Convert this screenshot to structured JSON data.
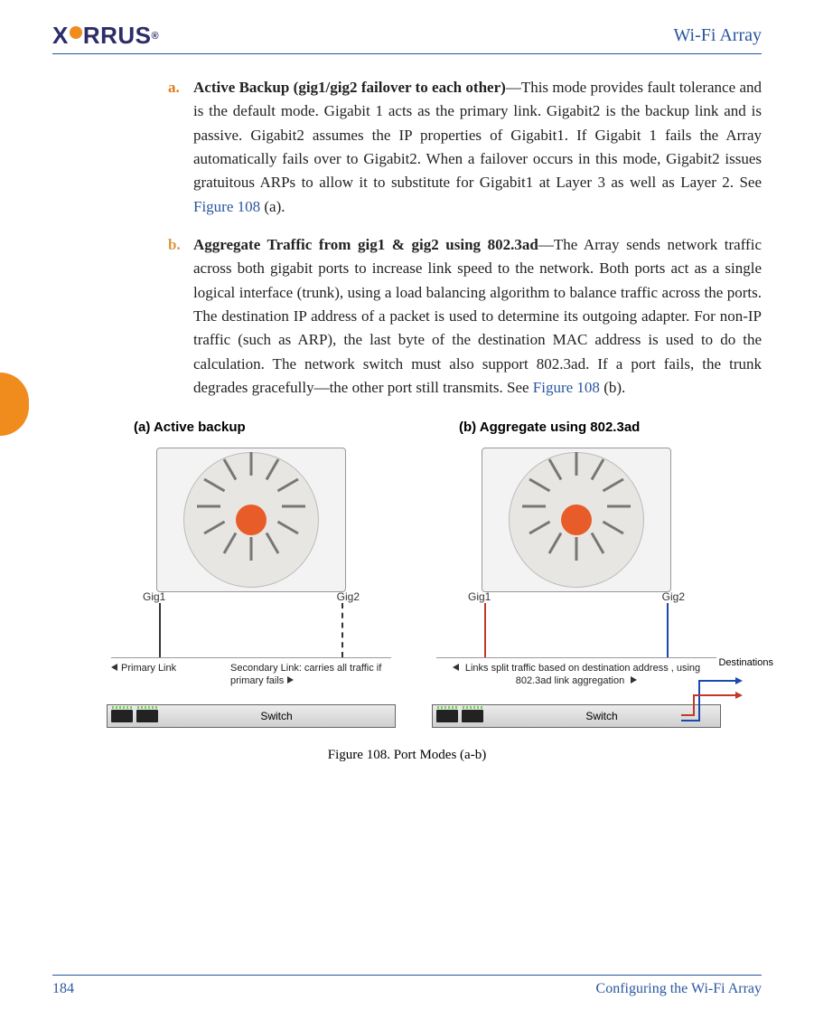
{
  "header": {
    "logo_text_1": "X",
    "logo_text_2": "RRUS",
    "logo_reg": "®",
    "doc_title": "Wi-Fi Array"
  },
  "items": {
    "a": {
      "marker": "a.",
      "title": "Active Backup (gig1/gig2 failover to each other)",
      "text_before": "—This mode provides fault tolerance and is the default mode. Gigabit 1 acts as the primary link. Gigabit2 is the backup link and is passive. Gigabit2 assumes the IP properties of Gigabit1. If Gigabit 1 fails the Array automatically fails over to Gigabit2.   When a failover occurs in this mode, Gigabit2 issues gratuitous ARPs to allow it to substitute for Gigabit1 at Layer 3 as well as Layer 2. See ",
      "figref": "Figure 108",
      "text_after": " (a)."
    },
    "b": {
      "marker": "b.",
      "title": "Aggregate Traffic from gig1 & gig2 using 802.3ad",
      "text_before": "—The Array sends network traffic across both gigabit ports to increase link speed to the network. Both ports act as a single logical interface (trunk), using a load balancing algorithm to balance traffic across the ports. The destination IP address of a packet is used to determine its outgoing adapter. For non-IP traffic (such as ARP), the last byte of the destination MAC address is used to do the calculation. The network switch must also support 802.3ad. If a port fails, the trunk degrades gracefully—the other port still transmits. See ",
      "figref": "Figure 108",
      "text_after": " (b)."
    }
  },
  "diagrams": {
    "a_title": "(a) Active backup",
    "b_title": "(b) Aggregate using 802.3ad",
    "gig1": "Gig1",
    "gig2": "Gig2",
    "a_primary": "Primary Link",
    "a_secondary": "Secondary Link: carries all traffic if primary fails",
    "b_ann": "Links split traffic based on destination address , using 802.3ad link aggregation",
    "switch": "Switch",
    "destinations": "Destinations"
  },
  "figure_caption": "Figure 108. Port Modes (a-b)",
  "footer": {
    "page_num": "184",
    "section": "Configuring the Wi-Fi Array"
  }
}
